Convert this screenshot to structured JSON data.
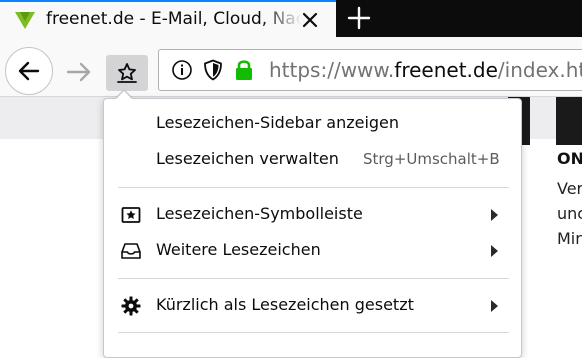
{
  "tab": {
    "title": "freenet.de - E-Mail, Cloud, Nachrichten",
    "favicon": "freenet-logo-icon",
    "close_icon": "close-icon",
    "new_tab_icon": "plus-icon"
  },
  "toolbar": {
    "back_icon": "arrow-left-icon",
    "forward_icon": "arrow-right-icon",
    "bookmark_icon": "bookmark-star-icon"
  },
  "urlbar": {
    "info_icon": "info-icon",
    "tracking_icon": "shield-icon",
    "lock_icon": "lock-icon",
    "url_prefix": "https://www.",
    "url_host": "freenet.de",
    "url_path": "/index.html"
  },
  "page": {
    "headline": "ON",
    "lines": [
      "Ver",
      "unc",
      "Mir"
    ]
  },
  "menu": {
    "items": [
      {
        "label": "Lesezeichen-Sidebar anzeigen"
      },
      {
        "label": "Lesezeichen verwalten",
        "shortcut": "Strg+Umschalt+B"
      },
      {
        "label": "Lesezeichen-Symbolleiste",
        "icon": "bookmarks-toolbar-icon"
      },
      {
        "label": "Weitere Lesezeichen",
        "icon": "inbox-tray-icon"
      },
      {
        "label": "Kürzlich als Lesezeichen gesetzt",
        "icon": "gear-icon"
      }
    ]
  },
  "colors": {
    "accent": "#0a84ff",
    "lock_green": "#12bc00",
    "brand_green": "#7dbd21",
    "tabbar": "#0c0c0d"
  }
}
